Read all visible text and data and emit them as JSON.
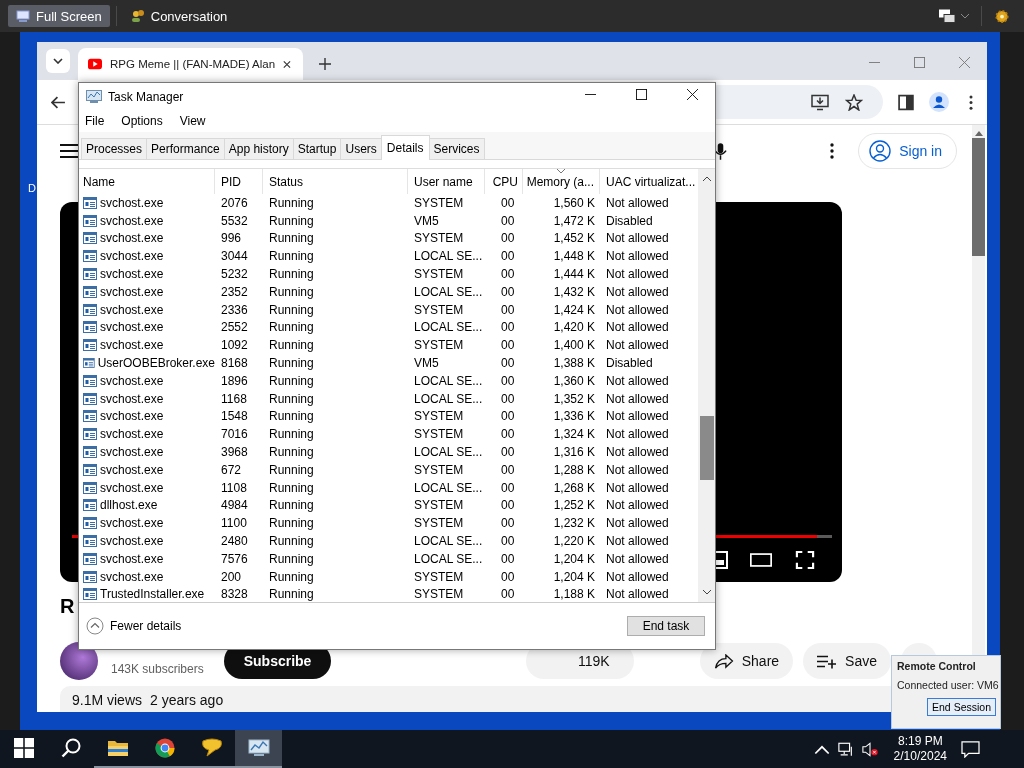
{
  "remote_bar": {
    "buttons": [
      {
        "label": "Full Screen",
        "selected": true
      },
      {
        "label": "Conversation",
        "selected": false
      }
    ]
  },
  "desktop": {
    "icon_label": "D"
  },
  "browser": {
    "tab_title": "RPG Meme || (FAN-MADE) Alan",
    "page": {
      "sign_in": "Sign in",
      "progress": {
        "level": 0.98
      },
      "title": "R",
      "subscribers": "143K subscribers",
      "subscribe": "Subscribe",
      "likes": "119K",
      "share": "Share",
      "save": "Save",
      "views": "9.1M views",
      "age": "2 years ago"
    }
  },
  "task_manager": {
    "title": "Task Manager",
    "menu": [
      "File",
      "Options",
      "View"
    ],
    "tabs": [
      {
        "label": "Processes",
        "selected": false
      },
      {
        "label": "Performance",
        "selected": false
      },
      {
        "label": "App history",
        "selected": false
      },
      {
        "label": "Startup",
        "selected": false
      },
      {
        "label": "Users",
        "selected": false
      },
      {
        "label": "Details",
        "selected": true
      },
      {
        "label": "Services",
        "selected": false
      }
    ],
    "columns": [
      {
        "label": "Name",
        "sorted": false
      },
      {
        "label": "PID",
        "sorted": false
      },
      {
        "label": "Status",
        "sorted": false
      },
      {
        "label": "User name",
        "sorted": false
      },
      {
        "label": "CPU",
        "sorted": false
      },
      {
        "label": "Memory (a...",
        "sorted": true
      },
      {
        "label": "UAC virtualizat...",
        "sorted": false
      }
    ],
    "rows": [
      [
        "svchost.exe",
        "2076",
        "Running",
        "SYSTEM",
        "00",
        "1,560 K",
        "Not allowed"
      ],
      [
        "svchost.exe",
        "5532",
        "Running",
        "VM5",
        "00",
        "1,472 K",
        "Disabled"
      ],
      [
        "svchost.exe",
        "996",
        "Running",
        "SYSTEM",
        "00",
        "1,452 K",
        "Not allowed"
      ],
      [
        "svchost.exe",
        "3044",
        "Running",
        "LOCAL SE...",
        "00",
        "1,448 K",
        "Not allowed"
      ],
      [
        "svchost.exe",
        "5232",
        "Running",
        "SYSTEM",
        "00",
        "1,444 K",
        "Not allowed"
      ],
      [
        "svchost.exe",
        "2352",
        "Running",
        "LOCAL SE...",
        "00",
        "1,432 K",
        "Not allowed"
      ],
      [
        "svchost.exe",
        "2336",
        "Running",
        "SYSTEM",
        "00",
        "1,424 K",
        "Not allowed"
      ],
      [
        "svchost.exe",
        "2552",
        "Running",
        "LOCAL SE...",
        "00",
        "1,420 K",
        "Not allowed"
      ],
      [
        "svchost.exe",
        "1092",
        "Running",
        "SYSTEM",
        "00",
        "1,400 K",
        "Not allowed"
      ],
      [
        "UserOOBEBroker.exe",
        "8168",
        "Running",
        "VM5",
        "00",
        "1,388 K",
        "Disabled"
      ],
      [
        "svchost.exe",
        "1896",
        "Running",
        "LOCAL SE...",
        "00",
        "1,360 K",
        "Not allowed"
      ],
      [
        "svchost.exe",
        "1168",
        "Running",
        "LOCAL SE...",
        "00",
        "1,352 K",
        "Not allowed"
      ],
      [
        "svchost.exe",
        "1548",
        "Running",
        "SYSTEM",
        "00",
        "1,336 K",
        "Not allowed"
      ],
      [
        "svchost.exe",
        "7016",
        "Running",
        "SYSTEM",
        "00",
        "1,324 K",
        "Not allowed"
      ],
      [
        "svchost.exe",
        "3968",
        "Running",
        "LOCAL SE...",
        "00",
        "1,316 K",
        "Not allowed"
      ],
      [
        "svchost.exe",
        "672",
        "Running",
        "SYSTEM",
        "00",
        "1,288 K",
        "Not allowed"
      ],
      [
        "svchost.exe",
        "1108",
        "Running",
        "LOCAL SE...",
        "00",
        "1,268 K",
        "Not allowed"
      ],
      [
        "dllhost.exe",
        "4984",
        "Running",
        "SYSTEM",
        "00",
        "1,252 K",
        "Not allowed"
      ],
      [
        "svchost.exe",
        "1100",
        "Running",
        "SYSTEM",
        "00",
        "1,232 K",
        "Not allowed"
      ],
      [
        "svchost.exe",
        "2480",
        "Running",
        "LOCAL SE...",
        "00",
        "1,220 K",
        "Not allowed"
      ],
      [
        "svchost.exe",
        "7576",
        "Running",
        "LOCAL SE...",
        "00",
        "1,204 K",
        "Not allowed"
      ],
      [
        "svchost.exe",
        "200",
        "Running",
        "SYSTEM",
        "00",
        "1,204 K",
        "Not allowed"
      ],
      [
        "TrustedInstaller.exe",
        "8328",
        "Running",
        "SYSTEM",
        "00",
        "1,188 K",
        "Not allowed"
      ]
    ],
    "fewer_details": "Fewer details",
    "end_task": "End task"
  },
  "remote_popup": {
    "title": "Remote Control",
    "user": "Connected user: VM6",
    "button": "End Session"
  },
  "taskbar": {
    "items": [
      {
        "kind": "start",
        "running": false,
        "active": false
      },
      {
        "kind": "search",
        "running": false,
        "active": false
      },
      {
        "kind": "folder",
        "running": true,
        "active": false
      },
      {
        "kind": "browser",
        "running": true,
        "active": false
      },
      {
        "kind": "chat",
        "running": true,
        "active": false
      },
      {
        "kind": "taskmgr",
        "running": true,
        "active": true
      }
    ],
    "time": "8:19 PM",
    "date": "2/10/2024"
  }
}
